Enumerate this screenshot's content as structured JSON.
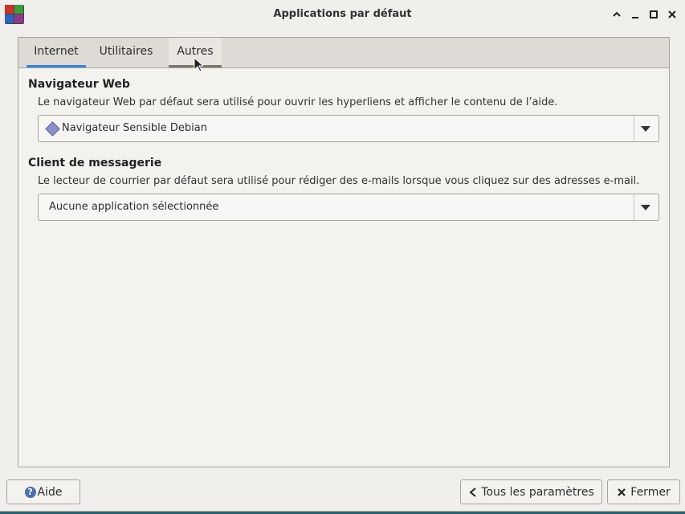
{
  "window": {
    "title": "Applications par défaut"
  },
  "tabs": [
    {
      "label": "Internet"
    },
    {
      "label": "Utilitaires"
    },
    {
      "label": "Autres"
    }
  ],
  "browser": {
    "title": "Navigateur Web",
    "description": "Le navigateur Web par défaut sera utilisé pour ouvrir les hyperliens et afficher le contenu de l’aide.",
    "selected": "Navigateur Sensible Debian",
    "icon": "debian-browser-icon"
  },
  "mail": {
    "title": "Client de messagerie",
    "description": "Le lecteur de courrier par défaut sera utilisé pour rédiger des e-mails lorsque vous cliquez sur des adresses e-mail.",
    "selected": "Aucune application sélectionnée"
  },
  "buttons": {
    "help": "Aide",
    "all_settings": "Tous les paramètres",
    "close": "Fermer"
  },
  "colors": {
    "accent": "#3b83d4",
    "desktop": "#2e5f68"
  }
}
